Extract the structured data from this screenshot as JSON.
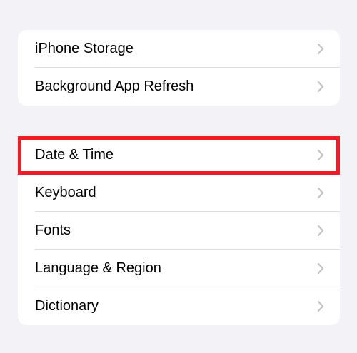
{
  "groups": [
    {
      "rows": [
        {
          "label": "iPhone Storage"
        },
        {
          "label": "Background App Refresh"
        }
      ]
    },
    {
      "rows": [
        {
          "label": "Date & Time"
        },
        {
          "label": "Keyboard"
        },
        {
          "label": "Fonts"
        },
        {
          "label": "Language & Region"
        },
        {
          "label": "Dictionary"
        }
      ]
    }
  ],
  "highlight": {
    "target": "Date & Time",
    "color": "#ee1c25"
  },
  "colors": {
    "background": "#f2f2f7",
    "card": "#ffffff",
    "chevron": "#c4c4c7",
    "divider": "#dcdce0"
  },
  "icons": {
    "row_chevron": "chevron-right-icon"
  }
}
